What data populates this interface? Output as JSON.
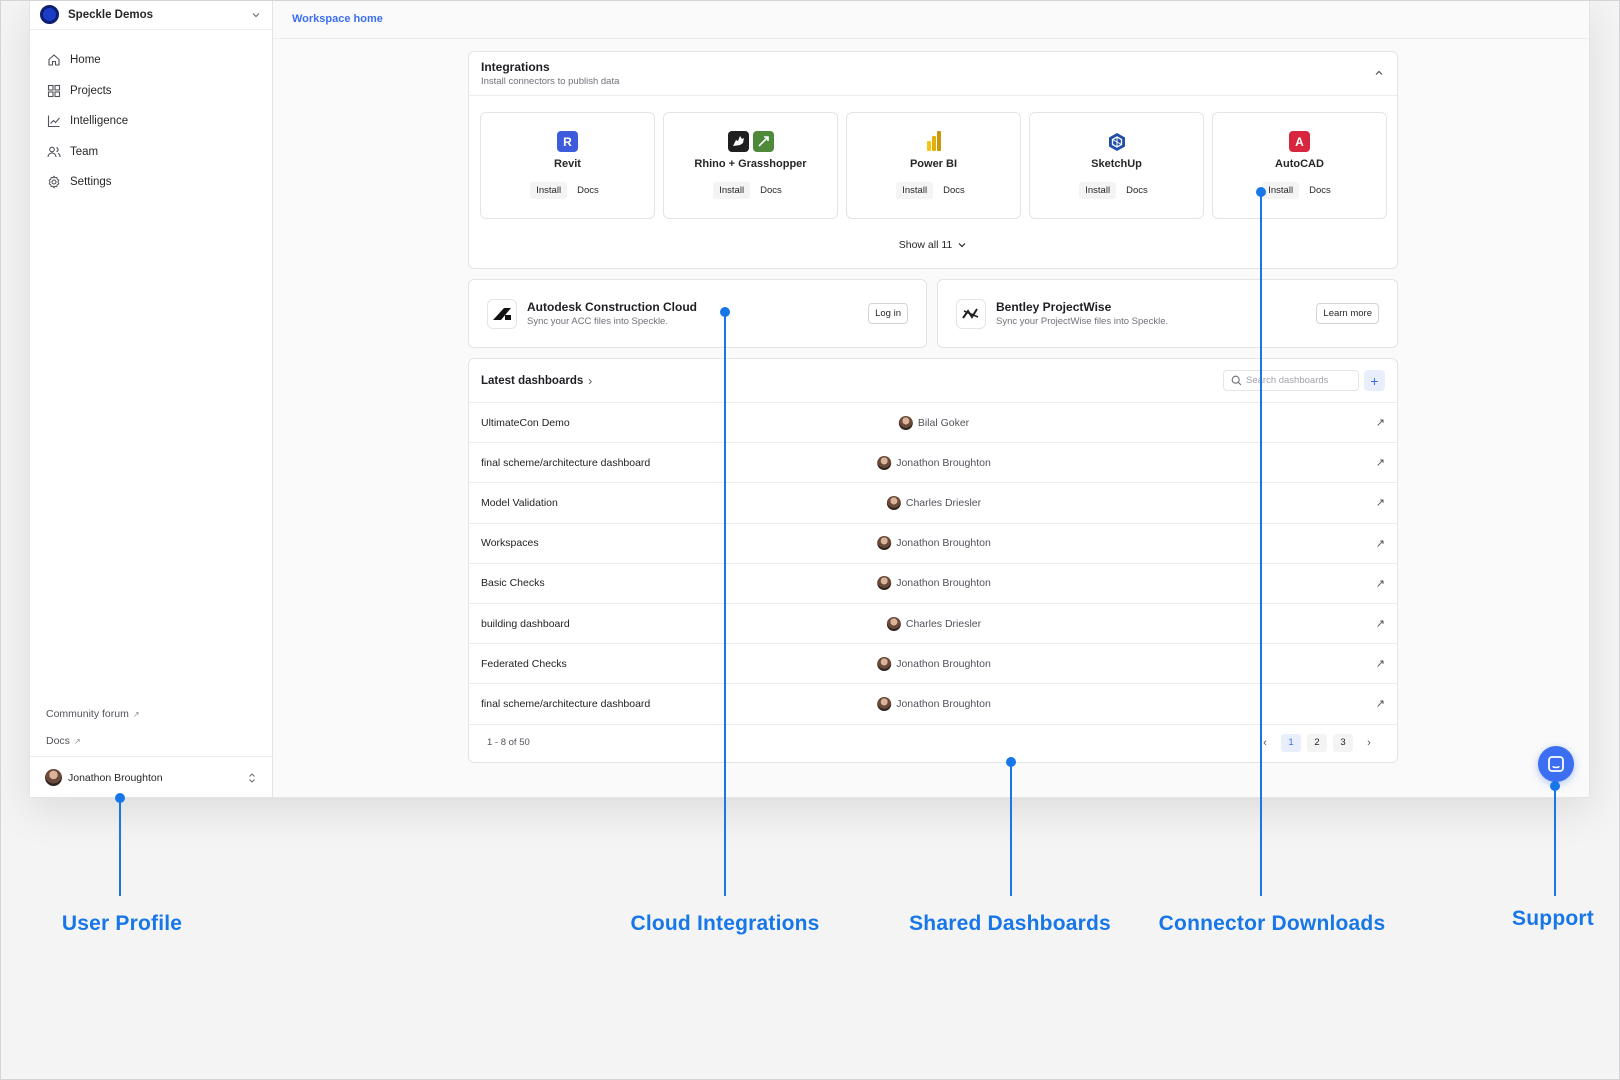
{
  "workspace": {
    "name": "Speckle Demos"
  },
  "nav": {
    "items": [
      {
        "label": "Home",
        "icon": "home-icon"
      },
      {
        "label": "Projects",
        "icon": "grid-icon"
      },
      {
        "label": "Intelligence",
        "icon": "chart-line-icon"
      },
      {
        "label": "Team",
        "icon": "users-icon"
      },
      {
        "label": "Settings",
        "icon": "gear-icon"
      }
    ],
    "footer_links": [
      "Community forum",
      "Docs"
    ]
  },
  "user": {
    "name": "Jonathon Broughton"
  },
  "breadcrumb": "Workspace home",
  "integrations": {
    "title": "Integrations",
    "subtitle": "Install connectors to publish data",
    "install_label": "Install",
    "docs_label": "Docs",
    "show_all": "Show all 11",
    "connectors": [
      {
        "name": "Revit",
        "icons": [
          {
            "glyph": "R",
            "color": "#3e5bdc"
          }
        ]
      },
      {
        "name": "Rhino + Grasshopper",
        "icons": [
          {
            "glyph": "",
            "color": "#1f1f1f"
          },
          {
            "glyph": "",
            "color": "#4f8a3a"
          }
        ]
      },
      {
        "name": "Power BI",
        "icons": [
          {
            "glyph": "",
            "color": "#f2c811"
          }
        ]
      },
      {
        "name": "SketchUp",
        "icons": [
          {
            "glyph": "",
            "color": "#1f4fa8"
          }
        ]
      },
      {
        "name": "AutoCAD",
        "icons": [
          {
            "glyph": "A",
            "color": "#d7263d"
          }
        ]
      }
    ]
  },
  "cloud": [
    {
      "name": "Autodesk Construction Cloud",
      "subtitle": "Sync your ACC files into Speckle.",
      "action": "Log in"
    },
    {
      "name": "Bentley ProjectWise",
      "subtitle": "Sync your ProjectWise files into Speckle.",
      "action": "Learn more"
    }
  ],
  "dashboards": {
    "title": "Latest dashboards",
    "search_placeholder": "Search dashboards",
    "rows": [
      {
        "name": "UltimateCon Demo",
        "owner": "Bilal Goker"
      },
      {
        "name": "final scheme/architecture dashboard",
        "owner": "Jonathon Broughton"
      },
      {
        "name": "Model Validation",
        "owner": "Charles Driesler"
      },
      {
        "name": "Workspaces",
        "owner": "Jonathon Broughton"
      },
      {
        "name": "Basic Checks",
        "owner": "Jonathon Broughton"
      },
      {
        "name": "building dashboard",
        "owner": "Charles Driesler"
      },
      {
        "name": "Federated Checks",
        "owner": "Jonathon Broughton"
      },
      {
        "name": "final scheme/architecture dashboard",
        "owner": "Jonathon Broughton"
      }
    ],
    "pagination": {
      "info": "1 - 8 of 50",
      "pages": [
        "1",
        "2",
        "3"
      ],
      "current": "1"
    }
  },
  "annotations": {
    "user_profile": "User Profile",
    "cloud_integrations": "Cloud Integrations",
    "shared_dashboards": "Shared Dashboards",
    "connector_downloads": "Connector Downloads",
    "support": "Support"
  },
  "colors": {
    "accent": "#3b6ef0",
    "annotation": "#1877e8"
  }
}
